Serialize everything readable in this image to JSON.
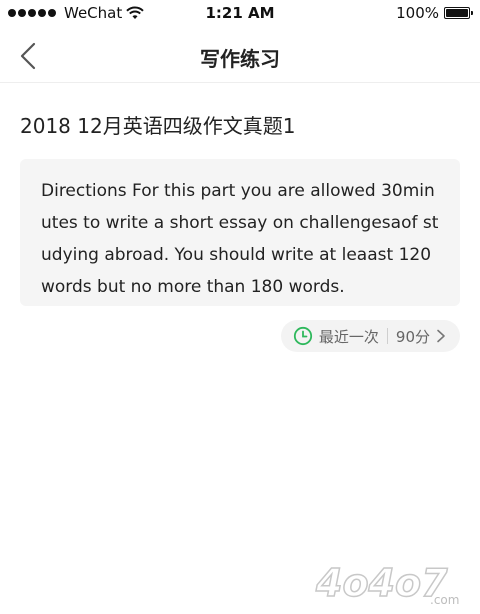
{
  "status_bar": {
    "carrier": "WeChat",
    "time": "1:21 AM",
    "battery": "100%"
  },
  "nav": {
    "title": "写作练习"
  },
  "question": {
    "title": "2018 12月英语四级作文真题1",
    "prompt": "Directions For this part you are allowed 30minutes to write a short essay on challengesaof studying abroad. You should write at leaast 120 words but no more than 180 words."
  },
  "history": {
    "label": "最近一次",
    "score": "90分"
  },
  "watermark": {
    "text": "4o4o7",
    "domain": ".com"
  },
  "colors": {
    "accent_green": "#2eb85c",
    "card_bg": "#f5f5f5"
  }
}
